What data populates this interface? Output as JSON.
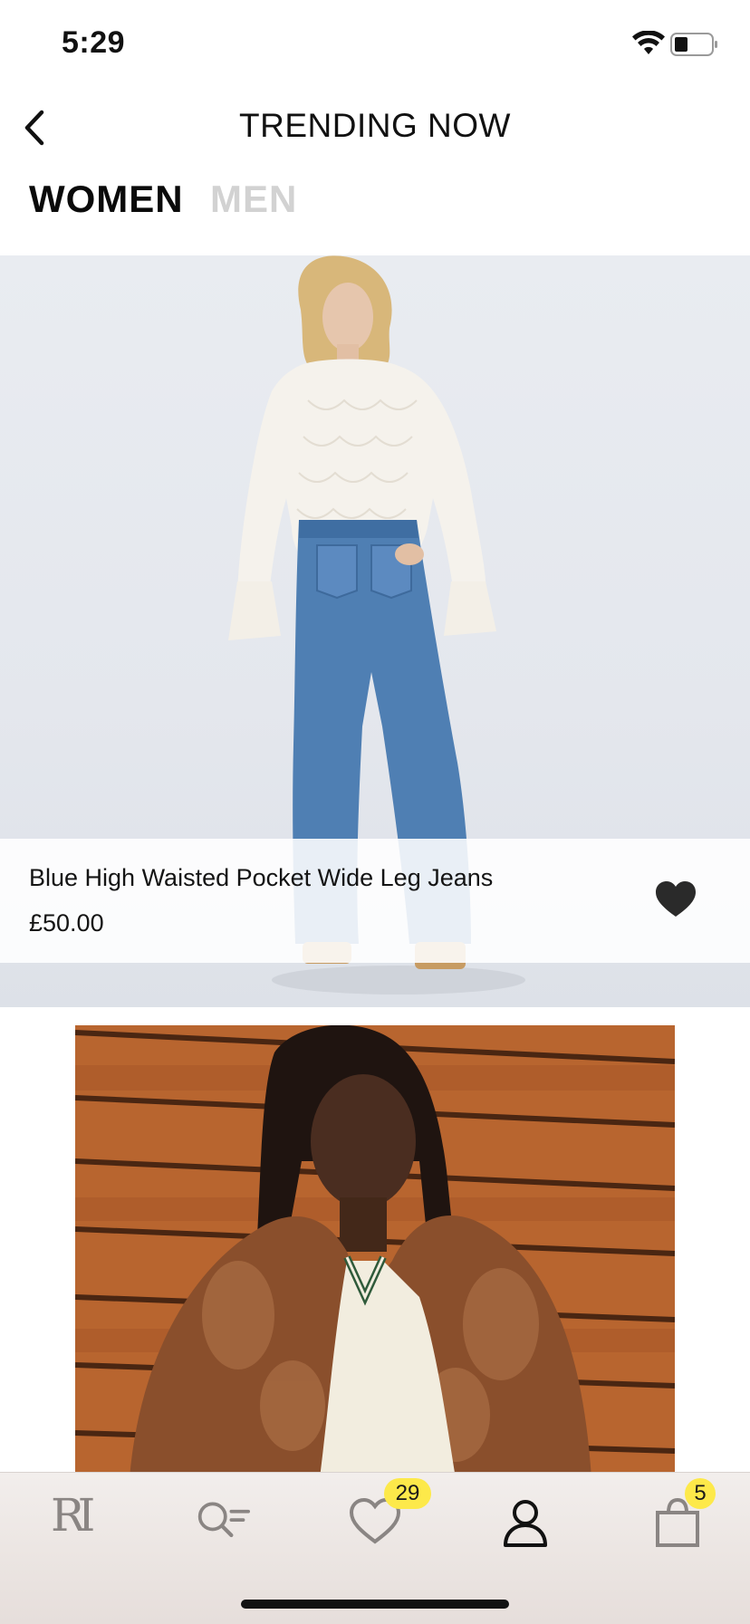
{
  "status_bar": {
    "time": "5:29",
    "icons": [
      "wifi-icon",
      "battery-icon"
    ]
  },
  "header": {
    "title": "TRENDING NOW",
    "back_icon": "chevron-left-icon"
  },
  "tabs": [
    {
      "label": "WOMEN",
      "selected": true
    },
    {
      "label": "MEN",
      "selected": false
    }
  ],
  "products": [
    {
      "name": "Blue High Waisted Pocket Wide Leg Jeans",
      "price": "£50.00",
      "favorited": true,
      "favorite_icon": "heart-filled-icon"
    },
    {
      "name": "",
      "price": ""
    }
  ],
  "tab_bar": {
    "logo": "RI",
    "items": [
      {
        "icon": "logo-icon"
      },
      {
        "icon": "search-filter-icon"
      },
      {
        "icon": "heart-outline-icon",
        "badge": "29"
      },
      {
        "icon": "account-icon"
      },
      {
        "icon": "bag-icon",
        "badge": "5"
      }
    ]
  },
  "colors": {
    "accent_badge": "#fde94a",
    "tab_inactive": "#d2d2d2",
    "text_primary": "#111111"
  }
}
